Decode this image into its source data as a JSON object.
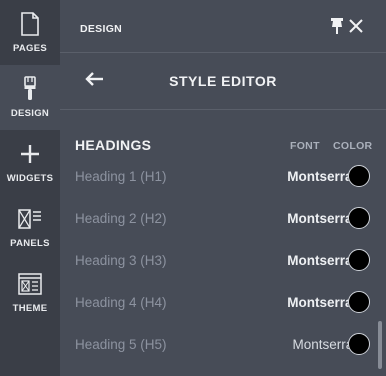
{
  "rail": {
    "items": [
      {
        "label": "PAGES"
      },
      {
        "label": "DESIGN"
      },
      {
        "label": "WIDGETS"
      },
      {
        "label": "PANELS"
      },
      {
        "label": "THEME"
      }
    ]
  },
  "panel": {
    "title": "DESIGN",
    "subtitle": "STYLE EDITOR"
  },
  "headings": {
    "section_title": "HEADINGS",
    "col_font": "FONT",
    "col_color": "COLOR",
    "rows": [
      {
        "name": "Heading 1 (H1)",
        "font": "Montserrat",
        "color": "#000000"
      },
      {
        "name": "Heading 2 (H2)",
        "font": "Montserrat",
        "color": "#000000"
      },
      {
        "name": "Heading 3 (H3)",
        "font": "Montserrat",
        "color": "#000000"
      },
      {
        "name": "Heading 4 (H4)",
        "font": "Montserrat",
        "color": "#000000"
      },
      {
        "name": "Heading 5 (H5)",
        "font": "Montserrat",
        "color": "#000000"
      }
    ]
  }
}
